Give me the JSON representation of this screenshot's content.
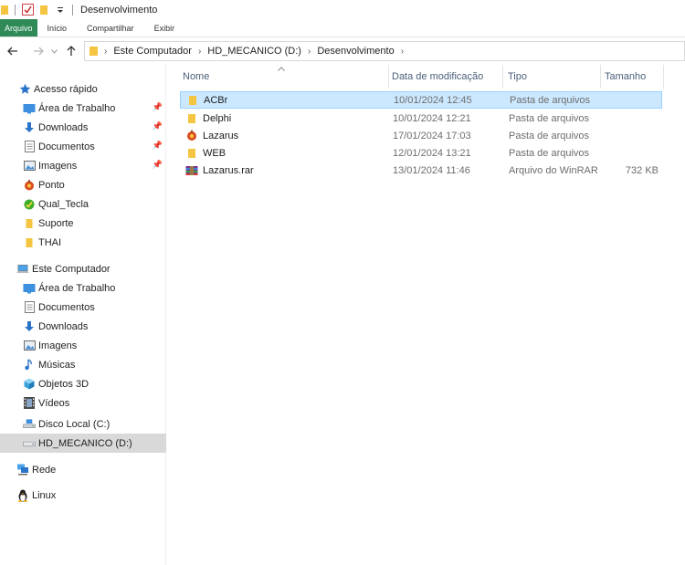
{
  "window": {
    "title": "Desenvolvimento"
  },
  "ribbon": {
    "tabs": [
      {
        "label": "Arquivo"
      },
      {
        "label": "Início"
      },
      {
        "label": "Compartilhar"
      },
      {
        "label": "Exibir"
      }
    ]
  },
  "address": {
    "crumbs": [
      "Este Computador",
      "HD_MECANICO (D:)",
      "Desenvolvimento"
    ]
  },
  "sidebar": {
    "quick_access": {
      "label": "Acesso rápido",
      "icon": "star-icon"
    },
    "quick_items": [
      {
        "label": "Área de Trabalho",
        "icon": "desktop-icon",
        "pinned": true
      },
      {
        "label": "Downloads",
        "icon": "download-arrow-icon",
        "pinned": true
      },
      {
        "label": "Documentos",
        "icon": "document-icon",
        "pinned": true
      },
      {
        "label": "Imagens",
        "icon": "image-icon",
        "pinned": true
      },
      {
        "label": "Ponto",
        "icon": "lazarus-icon",
        "pinned": false
      },
      {
        "label": "Qual_Tecla",
        "icon": "green-app-icon",
        "pinned": false
      },
      {
        "label": "Suporte",
        "icon": "folder-icon",
        "pinned": false
      },
      {
        "label": "THAI",
        "icon": "folder-icon",
        "pinned": false
      }
    ],
    "this_pc": {
      "label": "Este Computador",
      "icon": "computer-icon"
    },
    "pc_items": [
      {
        "label": "Área de Trabalho",
        "icon": "desktop-icon"
      },
      {
        "label": "Documentos",
        "icon": "document-icon"
      },
      {
        "label": "Downloads",
        "icon": "download-arrow-icon"
      },
      {
        "label": "Imagens",
        "icon": "image-icon"
      },
      {
        "label": "Músicas",
        "icon": "music-note-icon"
      },
      {
        "label": "Objetos 3D",
        "icon": "cube-3d-icon"
      },
      {
        "label": "Vídeos",
        "icon": "film-icon"
      },
      {
        "label": "Disco Local (C:)",
        "icon": "local-disk-icon"
      },
      {
        "label": "HD_MECANICO (D:)",
        "icon": "drive-icon",
        "selected": true
      }
    ],
    "network": {
      "label": "Rede",
      "icon": "network-icon"
    },
    "linux": {
      "label": "Linux",
      "icon": "penguin-icon"
    }
  },
  "filelist": {
    "columns": [
      "Nome",
      "Data de modificação",
      "Tipo",
      "Tamanho"
    ],
    "rows": [
      {
        "name": "ACBr",
        "date": "10/01/2024 12:45",
        "type": "Pasta de arquivos",
        "size": "",
        "icon": "folder-icon",
        "selected": true
      },
      {
        "name": "Delphi",
        "date": "10/01/2024 12:21",
        "type": "Pasta de arquivos",
        "size": "",
        "icon": "folder-icon",
        "selected": false
      },
      {
        "name": "Lazarus",
        "date": "17/01/2024 17:03",
        "type": "Pasta de arquivos",
        "size": "",
        "icon": "lazarus-icon",
        "selected": false
      },
      {
        "name": "WEB",
        "date": "12/01/2024 13:21",
        "type": "Pasta de arquivos",
        "size": "",
        "icon": "folder-icon",
        "selected": false
      },
      {
        "name": "Lazarus.rar",
        "date": "13/01/2024 11:46",
        "type": "Arquivo do WinRAR",
        "size": "732 KB",
        "icon": "winrar-icon",
        "selected": false
      }
    ]
  },
  "colors": {
    "accent_file_tab": "#2f8a58",
    "selection_bg": "#cce8ff",
    "selection_border": "#99d1ff",
    "folder": "#f5c542",
    "sidebar_selected": "#d9d9d9"
  }
}
